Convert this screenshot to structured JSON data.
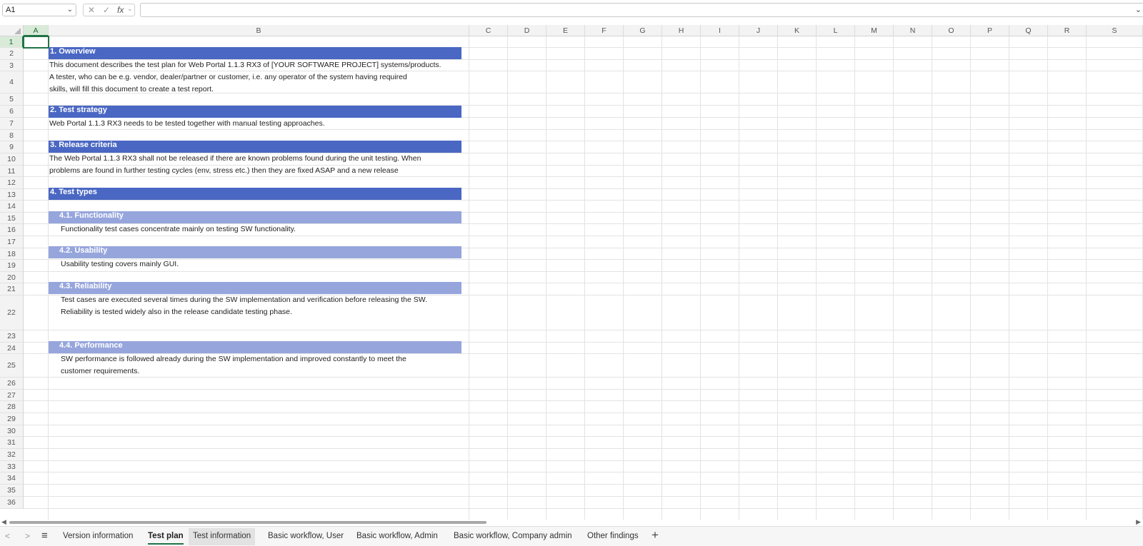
{
  "formula_bar": {
    "name_box": "A1",
    "name_box_dropdown": "⌄",
    "cancel_icon": "✕",
    "enter_icon": "✓",
    "fx_icon": "fx",
    "fx_dropdown": "⌄",
    "formula": "",
    "expand_icon": "⌄"
  },
  "columns": [
    "A",
    "B",
    "C",
    "D",
    "E",
    "F",
    "G",
    "H",
    "I",
    "J",
    "K",
    "L",
    "M",
    "N",
    "O",
    "P",
    "Q",
    "R",
    "S"
  ],
  "rows": [
    "1",
    "2",
    "3",
    "4",
    "5",
    "6",
    "7",
    "8",
    "9",
    "10",
    "11",
    "12",
    "13",
    "14",
    "15",
    "16",
    "17",
    "18",
    "19",
    "20",
    "21",
    "22",
    "23",
    "24",
    "25",
    "26",
    "27",
    "28",
    "29",
    "30",
    "31",
    "32",
    "33",
    "34",
    "35",
    "36"
  ],
  "content": {
    "overview": {
      "title": "1. Owerview",
      "line1": "This document describes the test plan for Web Portal 1.1.3 RX3 of [YOUR SOFTWARE PROJECT] systems/products.",
      "line2": "A tester, who can be e.g. vendor, dealer/partner or customer, i.e. any operator of the system having required",
      "line3": "skills, will fill this document to create a test report."
    },
    "strategy": {
      "title": "2. Test strategy",
      "line1": " Web Portal 1.1.3 RX3 needs to be tested together with manual testing approaches."
    },
    "release": {
      "title": "3. Release criteria",
      "line1": " The Web Portal 1.1.3 RX3 shall not be released if there are known problems found during the unit testing. When",
      "line2": "problems are found in further testing cycles (env, stress etc.) then they are fixed ASAP and a new release"
    },
    "types": {
      "title": "4. Test types",
      "functionality": {
        "title": "4.1. Functionality",
        "line1": "Functionality test cases concentrate mainly on testing SW functionality."
      },
      "usability": {
        "title": "4.2. Usability",
        "line1": "Usability testing covers mainly GUI."
      },
      "reliability": {
        "title": "4.3. Reliability",
        "line1": "Test cases are executed several times during the SW implementation and verification before releasing the SW.",
        "line2": "Reliability is tested widely also in the release candidate testing phase."
      },
      "performance": {
        "title": "4.4. Performance",
        "line1": "SW performance is followed already during the SW implementation and improved constantly to meet the",
        "line2": "customer requirements."
      }
    }
  },
  "sheet_tabs": {
    "prev": "<",
    "next": ">",
    "menu": "≡",
    "add": "+",
    "tabs": [
      "Version information",
      "Test plan",
      "Test information",
      "Basic workflow, User",
      "Basic workflow, Admin",
      "Basic workflow, Company admin",
      "Other findings"
    ],
    "active": "Test plan"
  },
  "colors": {
    "section": "#4a67c3",
    "subsection": "#96a5dc",
    "accent": "#217346"
  }
}
